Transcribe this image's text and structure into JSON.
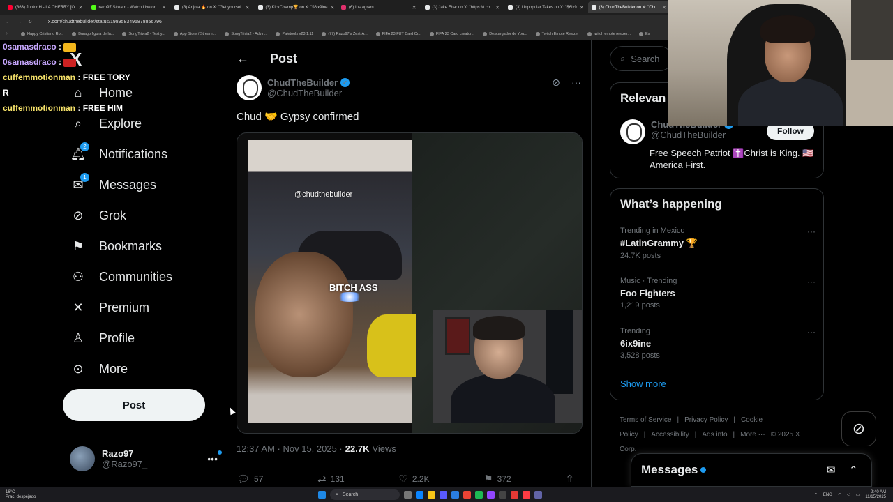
{
  "browser": {
    "tabs": [
      {
        "title": "(363) Junior H - LA CHERRY [O",
        "color": "#ff0033"
      },
      {
        "title": "razo97 Stream - Watch Live on",
        "color": "#53fc18"
      },
      {
        "title": "(3) Anjola 🔥 on X: \"Get yoursel",
        "color": "#e7e9ea"
      },
      {
        "title": "(3) KickChamp🏆 on X: \"$6ix9ine",
        "color": "#e7e9ea"
      },
      {
        "title": "(6) Instagram",
        "color": "#e1306c"
      },
      {
        "title": "(3) Jake Fhar on X: \"https://t.co",
        "color": "#e7e9ea"
      },
      {
        "title": "(3) Unpopular Takes on X: \"$6ix9",
        "color": "#e7e9ea"
      },
      {
        "title": "(3) ChudTheBuilder on X: \"Chu",
        "color": "#e7e9ea"
      }
    ],
    "url": "x.com/chudthebuilder/status/1989583495878856796",
    "bookmarks": [
      "Happy Cristiano Ro...",
      "Burago figura de la...",
      "SongTrivia2 - Test y...",
      "App Store / Streami...",
      "SongTrivia2 - Advin...",
      "Paletools v23.1.11",
      "(77) Razo97's Zest-A...",
      "FIFA 23 FUT Card Cr...",
      "FIFA 23 Card creator...",
      "Descargador de You...",
      "Twitch Emote Resizer",
      "twitch emote resizer...",
      "Es"
    ]
  },
  "chat": [
    {
      "user": "0samasdraco",
      "msg": "",
      "color": "#c8a8ff",
      "emote": "#f2b61c"
    },
    {
      "user": "0samasdraco",
      "msg": "",
      "color": "#c8a8ff",
      "emote": "#c22"
    },
    {
      "user": "cuffemmotionman",
      "msg": "FREE TORY",
      "color": "#f7e36a",
      "emote": ""
    },
    {
      "user": "R",
      "msg": "",
      "color": "#fff",
      "emote": ""
    },
    {
      "user": "cuffemmotionman",
      "msg": "FREE HIM",
      "color": "#f7e36a",
      "emote": ""
    }
  ],
  "nav": {
    "logo": "X",
    "items": [
      {
        "label": "Home",
        "icon": "home-icon",
        "glyph": "⌂",
        "badge": ""
      },
      {
        "label": "Explore",
        "icon": "search-icon",
        "glyph": "⌕",
        "badge": ""
      },
      {
        "label": "Notifications",
        "icon": "bell-icon",
        "glyph": "🔔︎",
        "badge": "2"
      },
      {
        "label": "Messages",
        "icon": "envelope-icon",
        "glyph": "✉",
        "badge": "1"
      },
      {
        "label": "Grok",
        "icon": "grok-icon",
        "glyph": "⊘",
        "badge": ""
      },
      {
        "label": "Bookmarks",
        "icon": "bookmark-icon",
        "glyph": "⚑",
        "badge": ""
      },
      {
        "label": "Communities",
        "icon": "communities-icon",
        "glyph": "⚇",
        "badge": ""
      },
      {
        "label": "Premium",
        "icon": "x-premium-icon",
        "glyph": "✕",
        "badge": ""
      },
      {
        "label": "Profile",
        "icon": "person-icon",
        "glyph": "♙",
        "badge": ""
      },
      {
        "label": "More",
        "icon": "more-circle-icon",
        "glyph": "⊙",
        "badge": ""
      }
    ],
    "post_button": "Post",
    "account": {
      "name": "Razo97",
      "handle": "@Razo97_"
    }
  },
  "post": {
    "header_title": "Post",
    "author_name": "ChudTheBuilder",
    "author_handle": "@ChudTheBuilder",
    "text": "Chud 🤝 Gypsy confirmed",
    "video_watermark": "@chudthebuilder",
    "video_caption": "BITCH ASS",
    "timestamp": "12:37 AM · Nov 15, 2025 · ",
    "views_count": "22.7K",
    "views_label": " Views",
    "replies": "57",
    "reposts": "131",
    "likes": "2.2K",
    "bookmarks": "372"
  },
  "sidebar": {
    "search_placeholder": "Search",
    "relevant_title": "Relevan",
    "relevant_user": {
      "name": "ChudTheBuilder",
      "handle": "@ChudTheBuilder",
      "follow_label": "Follow",
      "bio": "Free Speech Patriot ✝️Christ is King. 🇺🇸America First."
    },
    "happening_title": "What’s happening",
    "trends": [
      {
        "context": "Trending in Mexico",
        "name": "#LatinGrammy 🏆",
        "count": "24.7K posts"
      },
      {
        "context": "Music · Trending",
        "name": "Foo Fighters",
        "count": "1,219 posts"
      },
      {
        "context": "Trending",
        "name": "6ix9ine",
        "count": "3,528 posts"
      }
    ],
    "show_more": "Show more",
    "footer_links": [
      "Terms of Service",
      "|",
      "Privacy Policy",
      "|",
      "Cookie Policy",
      "|",
      "Accessibility",
      "|",
      "Ads info",
      "|",
      "More ···",
      "© 2025 X Corp."
    ],
    "messages_drawer": "Messages"
  },
  "taskbar": {
    "weather_temp": "16°C",
    "weather_desc": "Prac. despejado",
    "search_label": "Search",
    "lang": "ENG",
    "time": "2:40 AM",
    "date": "11/15/2025"
  },
  "colors": {
    "accent": "#1d9bf0",
    "bg": "#000000",
    "border": "#2f3336",
    "muted": "#71767b"
  }
}
